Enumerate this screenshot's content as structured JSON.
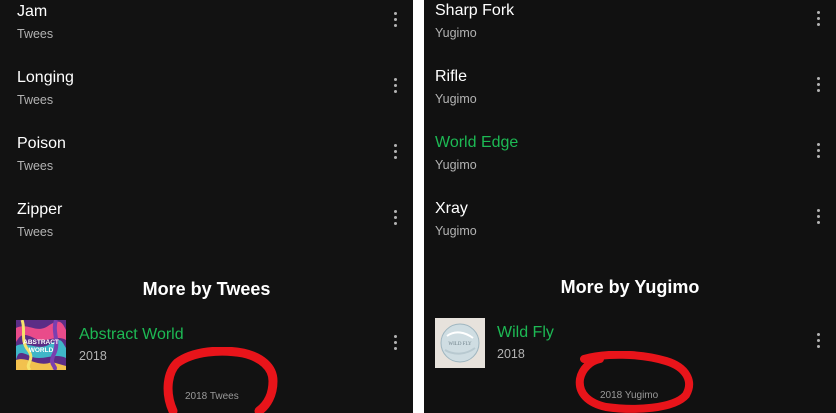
{
  "left_panel": {
    "tracks": [
      {
        "title": "Jam",
        "artist": "Twees"
      },
      {
        "title": "Longing",
        "artist": "Twees"
      },
      {
        "title": "Poison",
        "artist": "Twees"
      },
      {
        "title": "Zipper",
        "artist": "Twees"
      }
    ],
    "section_heading": "More by Twees",
    "album": {
      "title": "Abstract World",
      "year": "2018",
      "art_text_line1": "ABSTRACT",
      "art_text_line2": "WORLD"
    },
    "footer": "2018 Twees"
  },
  "right_panel": {
    "tracks": [
      {
        "title": "Sharp Fork",
        "artist": "Yugimo"
      },
      {
        "title": "Rifle",
        "artist": "Yugimo"
      },
      {
        "title": "World Edge",
        "artist": "Yugimo",
        "playing": true
      },
      {
        "title": "Xray",
        "artist": "Yugimo"
      }
    ],
    "section_heading": "More by Yugimo",
    "album": {
      "title": "Wild Fly",
      "year": "2018",
      "art_text": "WILD FLY"
    },
    "footer": "2018 Yugimo"
  },
  "colors": {
    "background": "#121212",
    "primary_text": "#ffffff",
    "secondary_text": "#b3b3b3",
    "accent_green": "#1db954",
    "annotation_red": "#e8141a"
  },
  "icons": [
    "more-options-icon"
  ]
}
